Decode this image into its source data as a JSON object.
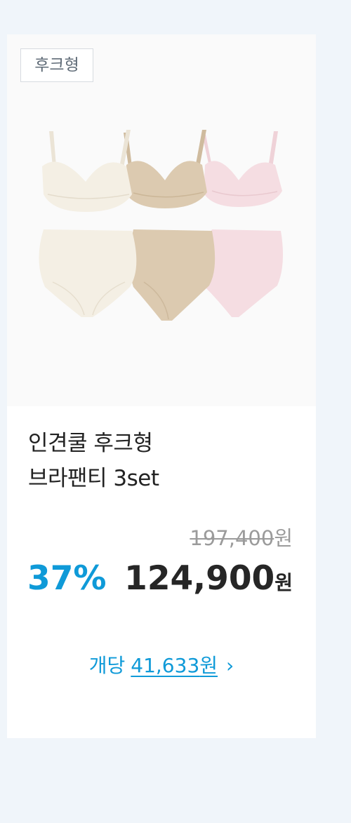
{
  "product": {
    "tag": "후크형",
    "title_line1": "인견쿨 후크형",
    "title_line2": "브라팬티 3set",
    "original_amount": "197,400",
    "discount": "37%",
    "sale_amount": "124,900",
    "currency": "원",
    "per_unit_label": "개당",
    "per_unit_amount": "41,633",
    "chevron": "›"
  },
  "colors": {
    "accent": "#0f9ad8",
    "ivory": "#f4efe4",
    "beige": "#dccab0",
    "pink": "#f5dde2"
  }
}
